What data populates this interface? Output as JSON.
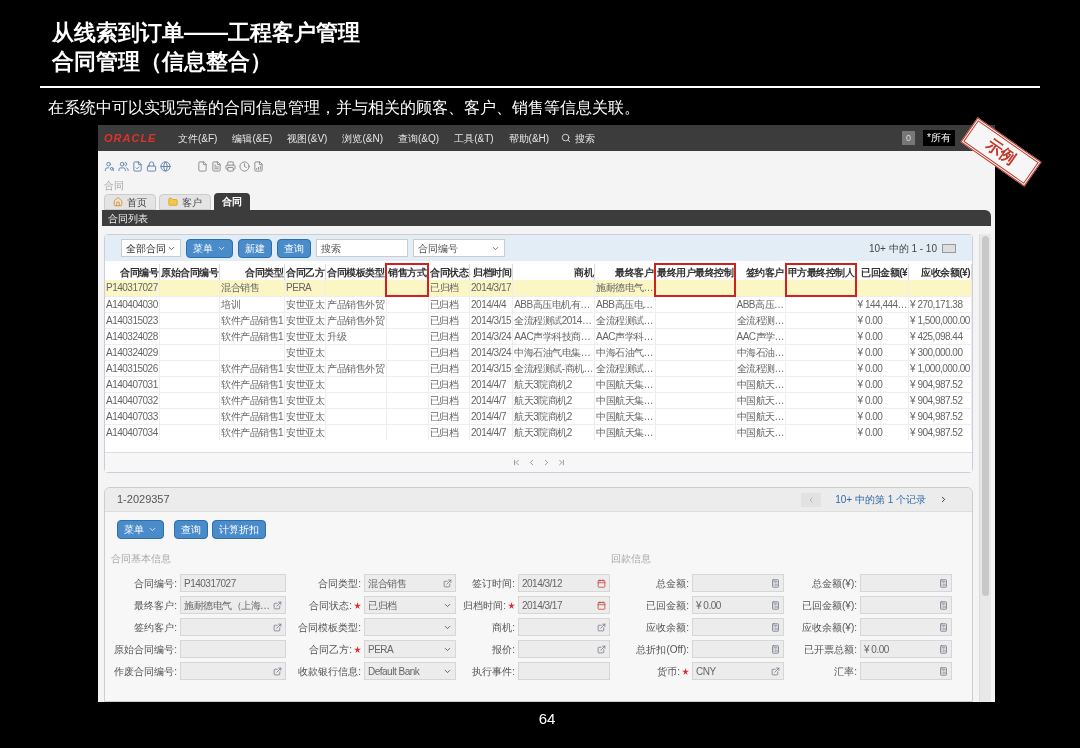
{
  "slide": {
    "title_lines": [
      "从线索到订单——工程客户管理",
      "合同管理（信息整合）"
    ],
    "subtitle": "在系统中可以实现完善的合同信息管理，并与相关的顾客、客户、销售等信息关联。",
    "page_number": "64",
    "stamp": "示例"
  },
  "app": {
    "logo": "ORACLE",
    "menus": [
      "文件(&F)",
      "编辑(&E)",
      "视图(&V)",
      "浏览(&N)",
      "查询(&Q)",
      "工具(&T)",
      "帮助(&H)"
    ],
    "search_label": "搜索",
    "badge": "0",
    "scope_field": "*所有"
  },
  "breadcrumb": "合同",
  "tabs": [
    {
      "label": "首页",
      "selected": false
    },
    {
      "label": "客户",
      "selected": false
    },
    {
      "label": "合同",
      "selected": true
    }
  ],
  "list": {
    "title": "合同列表",
    "filter": "全部合同",
    "menu_button": "菜单",
    "buttons": [
      "新建",
      "查询"
    ],
    "search_placeholder": "搜索",
    "search_field": "合同编号",
    "count": "10+ 中的 1 - 10",
    "columns": [
      {
        "label": "合同编号",
        "highlighted": false
      },
      {
        "label": "原始合同编号",
        "highlighted": false
      },
      {
        "label": "合同类型",
        "highlighted": false
      },
      {
        "label": "合同乙方",
        "highlighted": false
      },
      {
        "label": "合同模板类型",
        "highlighted": false
      },
      {
        "label": "销售方式",
        "highlighted": true
      },
      {
        "label": "合同状态",
        "highlighted": false
      },
      {
        "label": "归档时间",
        "highlighted": false
      },
      {
        "label": "商机",
        "highlighted": false
      },
      {
        "label": "最终客户",
        "highlighted": false
      },
      {
        "label": "最终用户最终控制",
        "highlighted": true
      },
      {
        "label": "签约客户",
        "highlighted": false
      },
      {
        "label": "甲方最终控制人",
        "highlighted": true
      },
      {
        "label": "已回金额(¥",
        "highlighted": false
      },
      {
        "label": "应收余额(¥)",
        "highlighted": false
      }
    ],
    "rows": [
      {
        "selected": true,
        "cells": [
          "P140317027",
          null,
          "混合销售",
          "PERA",
          null,
          null,
          "已归档",
          "2014/3/17",
          null,
          "施耐德电气…",
          null,
          null,
          null,
          null,
          null
        ]
      },
      {
        "selected": false,
        "cells": [
          "A140404030",
          null,
          "培训",
          "安世亚太",
          "产品销售外贸",
          null,
          "已归档",
          "2014/4/4",
          "ABB高压电机有…",
          "ABB高压电…",
          null,
          "ABB高压…",
          null,
          "¥ 144,444…",
          "¥ 270,171.38"
        ]
      },
      {
        "selected": false,
        "cells": [
          "A140315023",
          null,
          "软件产品销售1",
          "安世亚太",
          "产品销售外贸",
          null,
          "已归档",
          "2014/3/15",
          "全流程测试2014…",
          "全流程测试…",
          null,
          "全流程测…",
          null,
          "¥ 0.00",
          "¥ 1,500,000.00"
        ]
      },
      {
        "selected": false,
        "cells": [
          "A140324028",
          null,
          "软件产品销售1",
          "安世亚太",
          "升级",
          null,
          "已归档",
          "2014/3/24",
          "AAC声学科技商…",
          "AAC声学科…",
          null,
          "AAC声学…",
          null,
          "¥ 0.00",
          "¥ 425,098.44"
        ]
      },
      {
        "selected": false,
        "cells": [
          "A140324029",
          null,
          null,
          "安世亚太",
          null,
          null,
          "已归档",
          "2014/3/24",
          "中海石油气电集…",
          "中海石油气…",
          null,
          "中海石油…",
          null,
          "¥ 0.00",
          "¥ 300,000.00"
        ]
      },
      {
        "selected": false,
        "cells": [
          "A140315026",
          null,
          "软件产品销售1",
          "安世亚太",
          "产品销售外贸",
          null,
          "已归档",
          "2014/3/15",
          "全流程测试-商机…",
          "全流程测试…",
          null,
          "全流程测…",
          null,
          "¥ 0.00",
          "¥ 1,000,000.00"
        ]
      },
      {
        "selected": false,
        "cells": [
          "A140407031",
          null,
          "软件产品销售1",
          "安世亚太",
          null,
          null,
          "已归档",
          "2014/4/7",
          "航天3院商机2",
          "中国航天集…",
          null,
          "中国航天…",
          null,
          "¥ 0.00",
          "¥ 904,987.52"
        ]
      },
      {
        "selected": false,
        "cells": [
          "A140407032",
          null,
          "软件产品销售1",
          "安世亚太",
          null,
          null,
          "已归档",
          "2014/4/7",
          "航天3院商机2",
          "中国航天集…",
          null,
          "中国航天…",
          null,
          "¥ 0.00",
          "¥ 904,987.52"
        ]
      },
      {
        "selected": false,
        "cells": [
          "A140407033",
          null,
          "软件产品销售1",
          "安世亚太",
          null,
          null,
          "已归档",
          "2014/4/7",
          "航天3院商机2",
          "中国航天集…",
          null,
          "中国航天…",
          null,
          "¥ 0.00",
          "¥ 904,987.52"
        ]
      },
      {
        "selected": false,
        "cells": [
          "A140407034",
          null,
          "软件产品销售1",
          "安世亚太",
          null,
          null,
          "已归档",
          "2014/4/7",
          "航天3院商机2",
          "中国航天集…",
          null,
          "中国航天…",
          null,
          "¥ 0.00",
          "¥ 904,987.52"
        ]
      }
    ]
  },
  "detail": {
    "record_id": "1-2029357",
    "record_count": "10+ 中的第 1 个记录",
    "menu_button": "菜单",
    "buttons": [
      "查询",
      "计算折扣"
    ],
    "section_basic": "合同基本信息",
    "section_payment": "回款信息",
    "form_rows": [
      [
        {
          "label": "合同编号:",
          "kind": "text",
          "value": "P140317027",
          "required": false
        },
        {
          "label": "合同类型:",
          "kind": "lookup",
          "value": "混合销售",
          "required": false
        },
        {
          "label": "签订时间:",
          "kind": "date",
          "value": "2014/3/12",
          "required": false
        },
        {
          "label": "总金额:",
          "kind": "calc",
          "required": false
        },
        {
          "label": "总金额(¥):",
          "kind": "calc",
          "required": false
        }
      ],
      [
        {
          "label": "最终客户:",
          "kind": "lookup",
          "value": "施耐德电气（上海…",
          "required": false
        },
        {
          "label": "合同状态:",
          "kind": "select",
          "value": "已归档",
          "required": true
        },
        {
          "label": "归档时间:",
          "kind": "date",
          "value": "2014/3/17",
          "required": true
        },
        {
          "label": "已回金额:",
          "kind": "calc",
          "value": "¥ 0.00",
          "required": false
        },
        {
          "label": "已回金额(¥):",
          "kind": "calc",
          "required": false
        }
      ],
      [
        {
          "label": "签约客户:",
          "kind": "lookup",
          "required": false
        },
        {
          "label": "合同模板类型:",
          "kind": "select",
          "required": false
        },
        {
          "label": "商机:",
          "kind": "lookup",
          "required": false
        },
        {
          "label": "应收余额:",
          "kind": "calc",
          "required": false
        },
        {
          "label": "应收余额(¥):",
          "kind": "calc",
          "required": false
        }
      ],
      [
        {
          "label": "原始合同编号:",
          "kind": "text",
          "required": false
        },
        {
          "label": "合同乙方:",
          "kind": "select",
          "value": "PERA",
          "required": true
        },
        {
          "label": "报价:",
          "kind": "lookup",
          "required": false
        },
        {
          "label": "总折扣(Off):",
          "kind": "calc",
          "required": false
        },
        {
          "label": "已开票总额:",
          "kind": "calc",
          "value": "¥ 0.00",
          "required": false
        }
      ],
      [
        {
          "label": "作废合同编号:",
          "kind": "lookup",
          "required": false
        },
        {
          "label": "收款银行信息:",
          "kind": "select",
          "value": "Default Bank",
          "required": false
        },
        {
          "label": "执行事件:",
          "kind": "text",
          "required": false
        },
        {
          "label": "货币:",
          "kind": "lookup",
          "value": "CNY",
          "required": true
        },
        {
          "label": "汇率:",
          "kind": "calc",
          "required": false
        }
      ]
    ]
  }
}
